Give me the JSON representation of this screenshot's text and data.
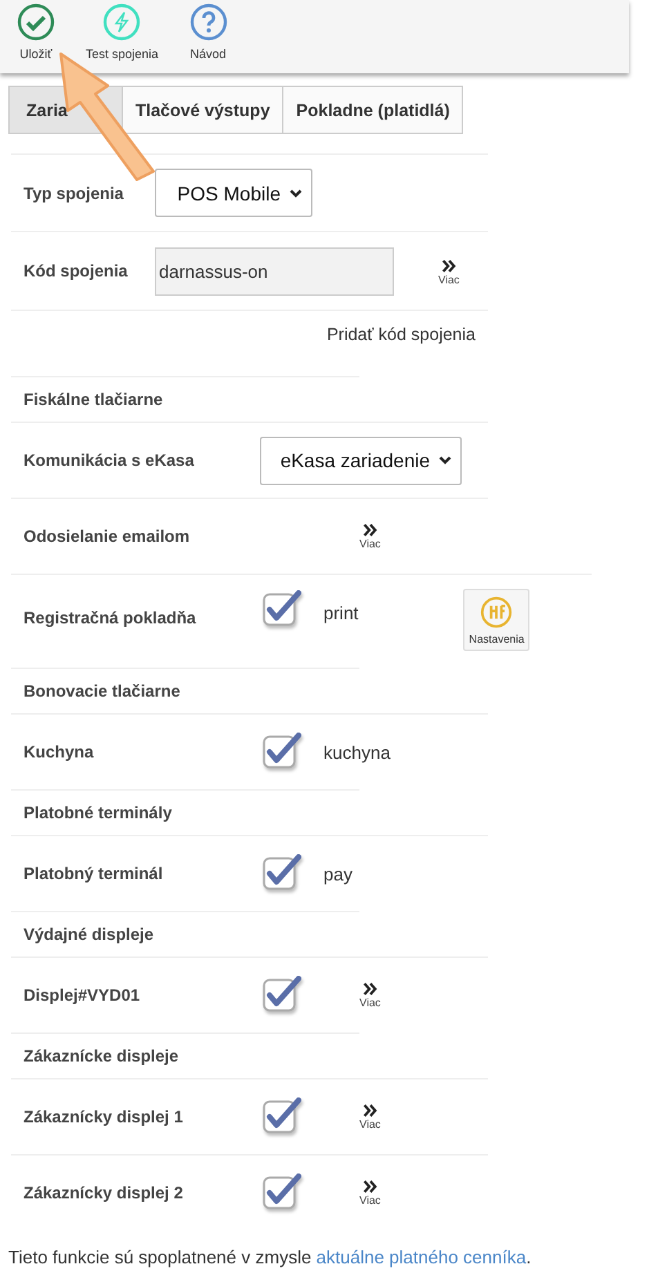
{
  "toolbar": [
    {
      "kind": "save",
      "label": "Uložiť"
    },
    {
      "kind": "test",
      "label": "Test spojenia"
    },
    {
      "kind": "help",
      "label": "Návod"
    }
  ],
  "tabs": [
    {
      "label": "Zaria",
      "selected": true
    },
    {
      "label": "Tlačové výstupy",
      "selected": false
    },
    {
      "label": "Pokladne (platidlá)",
      "selected": false
    }
  ],
  "connection": {
    "type_label": "Typ spojenia",
    "type_value": "POS Mobile",
    "code_label": "Kód spojenia",
    "code_value": "darnassus-on",
    "code_more": "Viac",
    "add_code": "Pridať kód spojenia"
  },
  "sections": [
    {
      "title": "Fiskálne tlačiarne",
      "rows": [
        {
          "kind": "select",
          "label": "Komunikácia s eKasa",
          "value": "eKasa zariadenie"
        },
        {
          "kind": "device",
          "label": "Odosielanie emailom",
          "more": "Viac"
        },
        {
          "kind": "device",
          "label": "Registračná pokladňa",
          "checked": true,
          "name": "print",
          "settings": "Nastavenia"
        }
      ]
    },
    {
      "title": "Bonovacie tlačiarne",
      "rows": [
        {
          "kind": "device",
          "label": "Kuchyna",
          "checked": true,
          "name": "kuchyna"
        }
      ]
    },
    {
      "title": "Platobné terminály",
      "rows": [
        {
          "kind": "device",
          "label": "Platobný terminál",
          "checked": true,
          "name": "pay"
        }
      ]
    },
    {
      "title": "Výdajné displeje",
      "rows": [
        {
          "kind": "device",
          "label": "Displej#VYD01",
          "checked": true,
          "more": "Viac"
        }
      ]
    },
    {
      "title": "Zákaznícke displeje",
      "rows": [
        {
          "kind": "device",
          "label": "Zákaznícky displej 1",
          "checked": true,
          "more": "Viac"
        },
        {
          "kind": "device",
          "label": "Zákaznícky displej 2",
          "checked": true,
          "more": "Viac"
        }
      ]
    }
  ],
  "footer": {
    "text": "Tieto funkcie sú spoplatnené v zmysle",
    "link": "aktuálne platného cenníka",
    "end": "."
  }
}
